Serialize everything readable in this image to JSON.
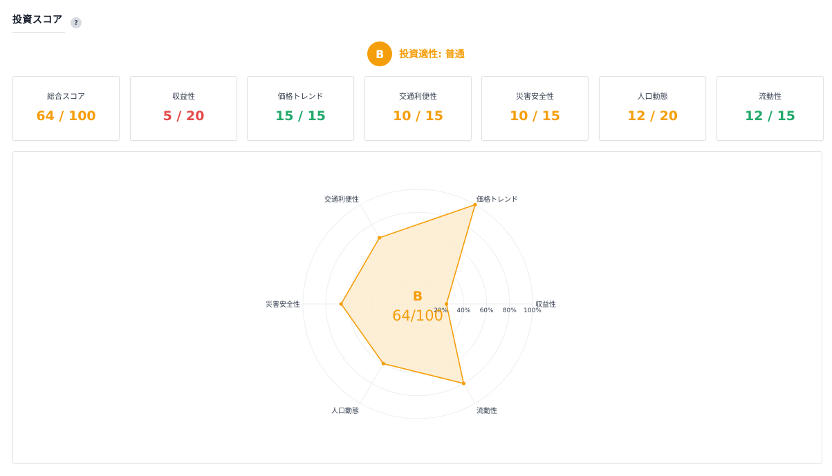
{
  "header": {
    "title": "投資スコア",
    "help_icon": "?"
  },
  "grade": {
    "letter": "B",
    "label": "投資適性: 普通",
    "color": "#f59e0b"
  },
  "cards": [
    {
      "label": "総合スコア",
      "value": "64 / 100",
      "color": "#f59e0b"
    },
    {
      "label": "収益性",
      "value": "5 / 20",
      "color": "#e34a4a"
    },
    {
      "label": "価格トレンド",
      "value": "15 / 15",
      "color": "#22a86b"
    },
    {
      "label": "交通利便性",
      "value": "10 / 15",
      "color": "#f59e0b"
    },
    {
      "label": "災害安全性",
      "value": "10 / 15",
      "color": "#f59e0b"
    },
    {
      "label": "人口動態",
      "value": "12 / 20",
      "color": "#f59e0b"
    },
    {
      "label": "流動性",
      "value": "12 / 15",
      "color": "#22a86b"
    }
  ],
  "chart_data": {
    "type": "radar",
    "axes": [
      "収益性",
      "価格トレンド",
      "交通利便性",
      "災害安全性",
      "人口動態",
      "流動性"
    ],
    "values": [
      25,
      100,
      66.7,
      66.7,
      60,
      80
    ],
    "ticks": [
      "20%",
      "40%",
      "60%",
      "80%",
      "100%"
    ],
    "rlim": [
      0,
      100
    ],
    "center_label": {
      "grade": "B",
      "score": "64/100"
    },
    "color": "#f59e0b",
    "fill": "#fdebcf"
  }
}
